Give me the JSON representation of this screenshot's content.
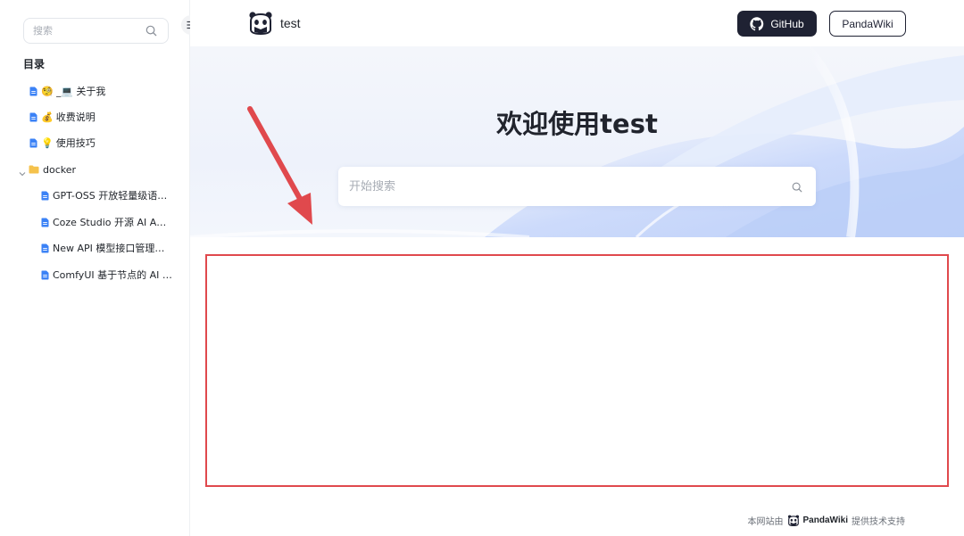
{
  "sidebar": {
    "search_placeholder": "搜索",
    "toc_title": "目录",
    "items": [
      {
        "emoji": "🧐",
        "label": "_💻 关于我"
      },
      {
        "emoji": "💰",
        "label": "收费说明"
      },
      {
        "emoji": "💡",
        "label": "使用技巧"
      },
      {
        "label": "docker"
      },
      {
        "label": "GPT-OSS 开放轻量级语言模型"
      },
      {
        "label": "Coze Studio 开源 AI Agent 开发平台"
      },
      {
        "label": "New API 模型接口管理与分发"
      },
      {
        "label": "ComfyUI 基于节点的 AI 绘图工具"
      }
    ]
  },
  "header": {
    "site_name": "test",
    "github_label": "GitHub",
    "pandawiki_label": "PandaWiki"
  },
  "hero": {
    "title": "欢迎使用test",
    "search_placeholder": "开始搜索"
  },
  "footer": {
    "prefix": "本网站由",
    "brand": "PandaWiki",
    "suffix": "提供技术支持"
  },
  "colors": {
    "accent": "#1f2233",
    "doc_icon": "#3b82f6",
    "folder_icon": "#f5c24c",
    "annotation": "#e0494d"
  }
}
